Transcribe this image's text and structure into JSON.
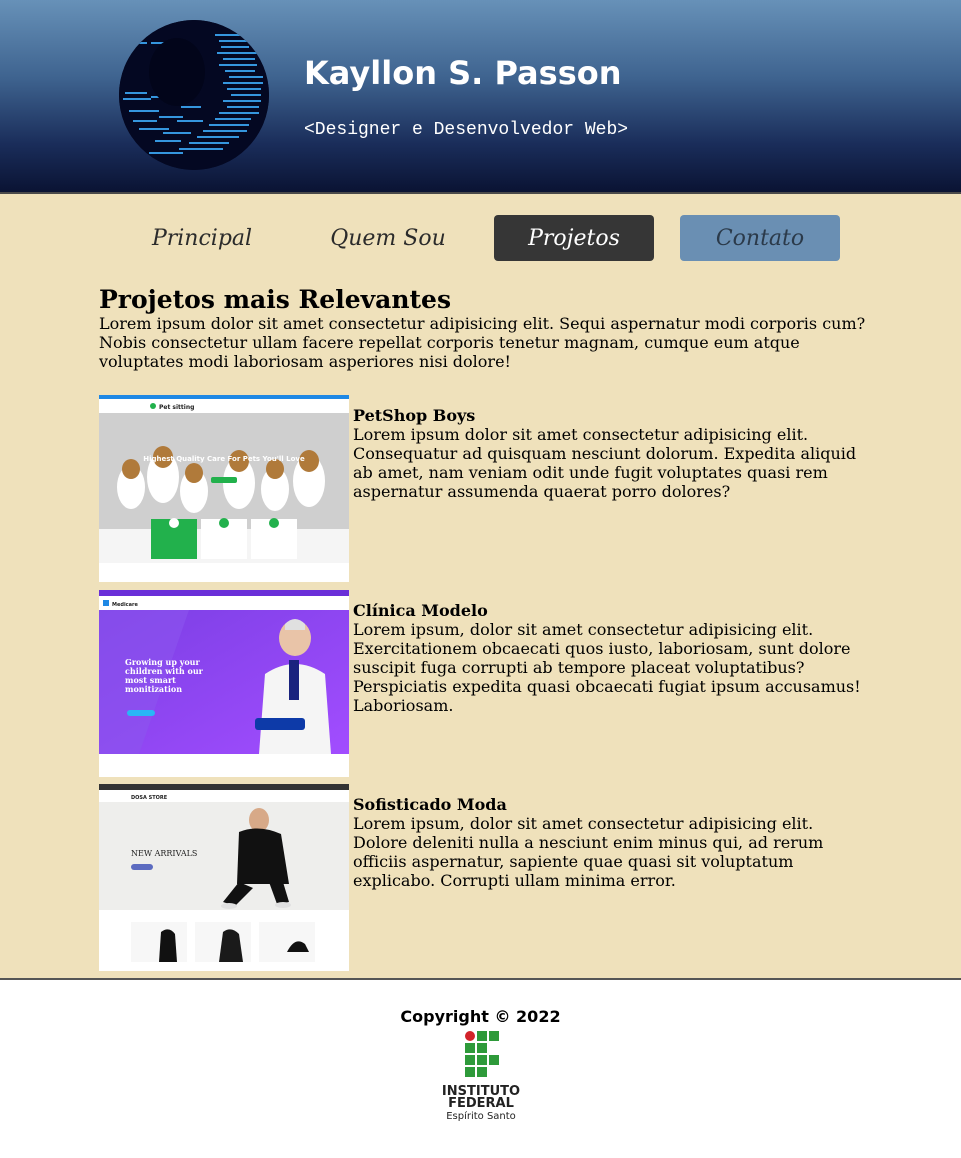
{
  "header": {
    "name": "Kayllon S. Passon",
    "subtitle": "<Designer e Desenvolvedor Web>"
  },
  "nav": {
    "items": [
      {
        "label": "Principal"
      },
      {
        "label": "Quem Sou"
      },
      {
        "label": "Projetos",
        "active": true
      },
      {
        "label": "Contato"
      }
    ]
  },
  "main": {
    "title": "Projetos mais Relevantes",
    "intro": "Lorem ipsum dolor sit amet consectetur adipisicing elit. Sequi aspernatur modi corporis cum? Nobis consectetur ullam facere repellat corporis tenetur magnam, cumque eum atque voluptates modi laboriosam asperiores nisi dolore!",
    "projects": [
      {
        "title": "PetShop Boys",
        "description": "Lorem ipsum dolor sit amet consectetur adipisicing elit. Consequatur ad quisquam nesciunt dolorum. Expedita aliquid ab amet, nam veniam odit unde fugit voluptates quasi rem aspernatur assumenda quaerat porro dolores?",
        "thumb_headline": "Highest Quality Care For Pets You'll Love",
        "thumb_brand": "Pet sitting"
      },
      {
        "title": "Clínica Modelo",
        "description": "Lorem ipsum, dolor sit amet consectetur adipisicing elit. Exercitationem obcaecati quos iusto, laboriosam, sunt dolore suscipit fuga corrupti ab tempore placeat voluptatibus? Perspiciatis expedita quasi obcaecati fugiat ipsum accusamus! Laboriosam.",
        "thumb_headline": "Growing up your children with our most smart monitization",
        "thumb_brand": "Medicare"
      },
      {
        "title": "Sofisticado Moda",
        "description": "Lorem ipsum, dolor sit amet consectetur adipisicing elit. Dolore deleniti nulla a nesciunt enim minus qui, ad rerum officiis aspernatur, sapiente quae quasi sit voluptatum explicabo. Corrupti ullam minima error.",
        "thumb_headline": "NEW ARRIVALS",
        "thumb_brand": "DOSA STORE"
      }
    ]
  },
  "footer": {
    "copyright": "Copyright © 2022",
    "logo_line1": "INSTITUTO",
    "logo_line2": "FEDERAL",
    "logo_line3": "Espírito Santo"
  },
  "colors": {
    "header_top": "#6791b8",
    "header_bottom": "#0a1333",
    "content_bg": "#efe1bb",
    "nav_active": "#363636",
    "nav_contact": "#6a8fb3",
    "if_green": "#2e9a3a",
    "if_red": "#d2232a"
  }
}
